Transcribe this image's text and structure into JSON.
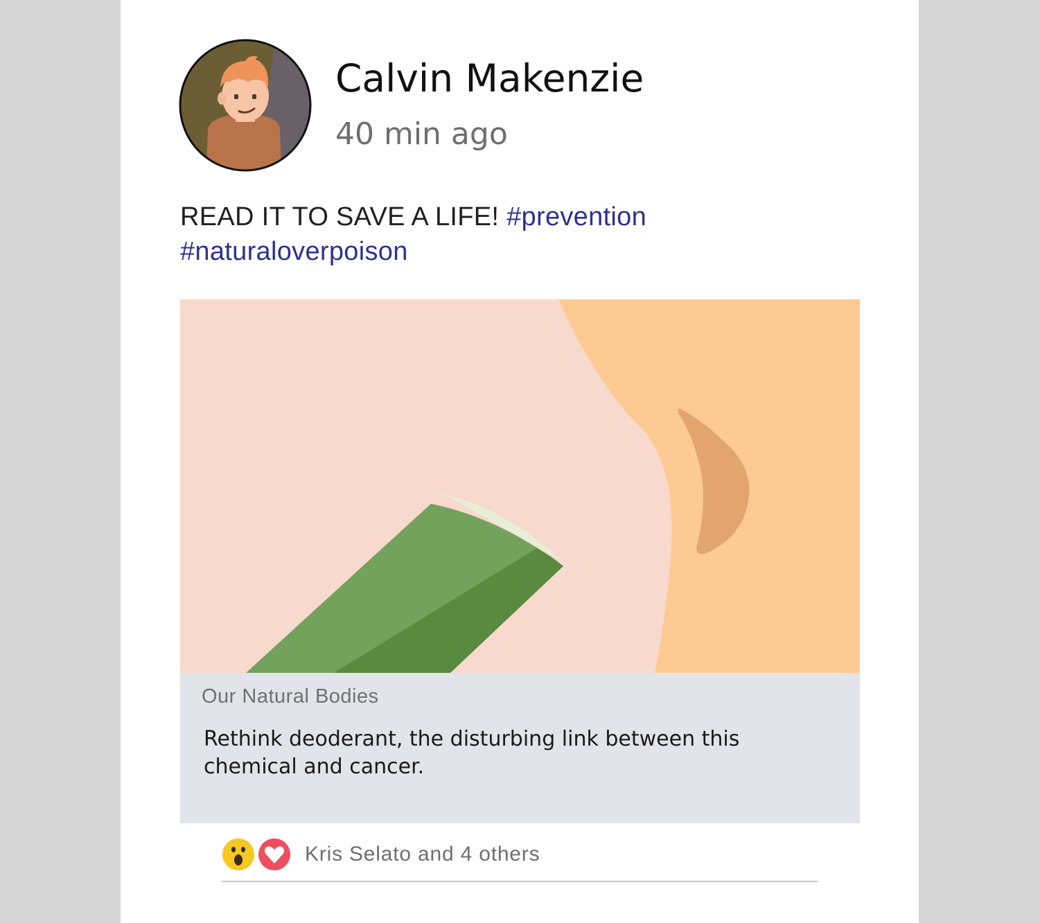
{
  "post": {
    "author_name": "Calvin Makenzie",
    "time_ago": "40 min ago",
    "text": "READ IT TO SAVE A LIFE!",
    "hashtags": [
      "#prevention",
      "#naturaloverpoison"
    ],
    "avatar_icon": "person-avatar-icon"
  },
  "link_preview": {
    "source": "Our Natural Bodies",
    "title": "Rethink deoderant, the disturbing link between this chemical and cancer.",
    "image_icon": "deodorant-illustration"
  },
  "reactions": {
    "icons": [
      "wow-reaction-icon",
      "love-reaction-icon"
    ],
    "summary": "Kris Selato and 4 others"
  },
  "colors": {
    "hashtag": "#2e3192",
    "background": "#d6d6d6",
    "card": "#ffffff",
    "preview_meta": "#e3e3ea"
  }
}
